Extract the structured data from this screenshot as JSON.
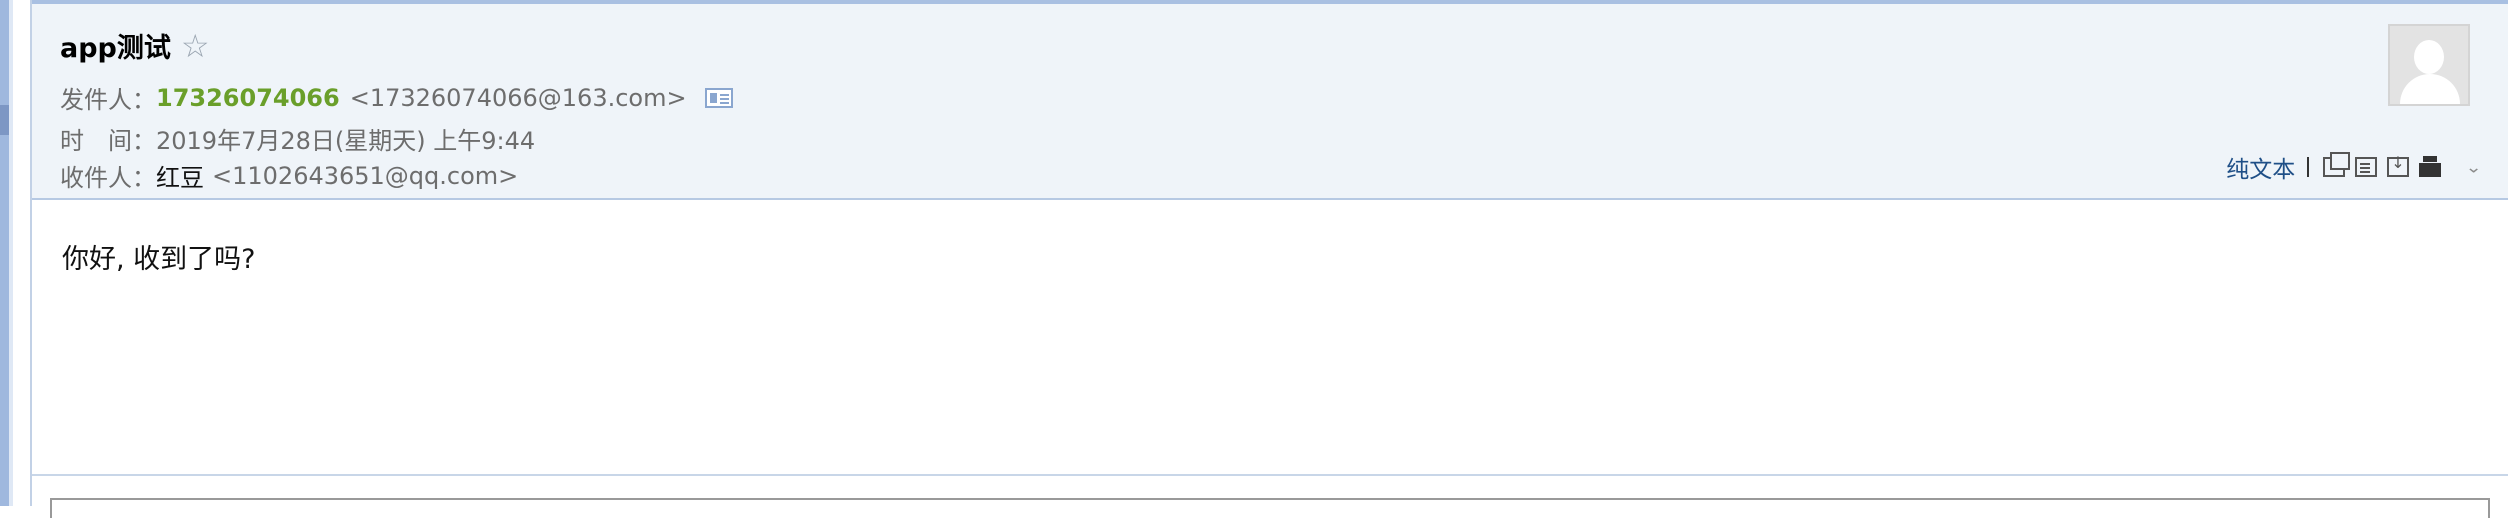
{
  "email": {
    "subject": "app测试",
    "star_icon": "star-outline-icon",
    "from_label": "发件人：",
    "sender_name": "17326074066",
    "sender_address": "<17326074066@163.com>",
    "contact_card_icon": "contact-card-icon",
    "time_label": "时　间：",
    "time_value": "2019年7月28日(星期天) 上午9:44",
    "to_label": "收件人：",
    "recipient_name": "红豆",
    "recipient_address": "<1102643651@qq.com>",
    "body": "你好, 收到了吗?"
  },
  "toolbar": {
    "plain_text_label": "纯文本",
    "icons": [
      "new-window-icon",
      "document-icon",
      "save-icon",
      "print-icon",
      "expand-chevron-icon"
    ]
  },
  "colors": {
    "header_bg": "#eff4f9",
    "sender_name": "#6a9f2a",
    "link": "#1f4f87"
  }
}
